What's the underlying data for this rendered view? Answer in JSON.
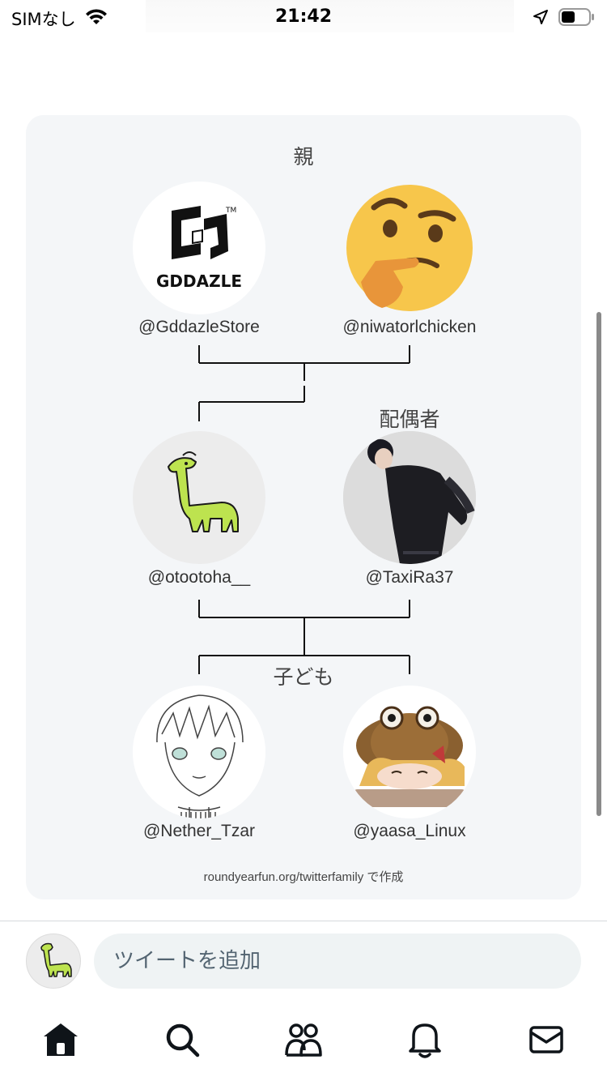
{
  "status_bar": {
    "carrier": "SIMなし",
    "time": "21:42"
  },
  "family_card": {
    "parents_label": "親",
    "spouse_label": "配偶者",
    "children_label": "子ども",
    "parents": [
      {
        "handle": "@GddazleStore",
        "avatar_icon": "gddazle-logo-icon",
        "logo_text": "GDDAZLE"
      },
      {
        "handle": "@niwatorlchicken",
        "avatar_icon": "thinking-face-icon"
      }
    ],
    "self": {
      "handle": "@otootoha__",
      "avatar_icon": "giraffe-icon"
    },
    "spouse": {
      "handle": "@TaxiRa37",
      "avatar_icon": "person-photo-icon"
    },
    "children": [
      {
        "handle": "@Nether_Tzar",
        "avatar_icon": "sketch-portrait-icon"
      },
      {
        "handle": "@yaasa_Linux",
        "avatar_icon": "anime-character-icon"
      }
    ],
    "credit": "roundyearfun.org/twitterfamily で作成"
  },
  "reply_bar": {
    "placeholder": "ツイートを追加"
  },
  "tab_bar": {
    "items": [
      "home-icon",
      "search-icon",
      "communities-icon",
      "notifications-icon",
      "messages-icon"
    ]
  },
  "colors": {
    "card_background": "#f4f6f8",
    "giraffe": "#bde34f",
    "emoji_yellow": "#f7c64b",
    "input_background": "#eff3f4"
  }
}
